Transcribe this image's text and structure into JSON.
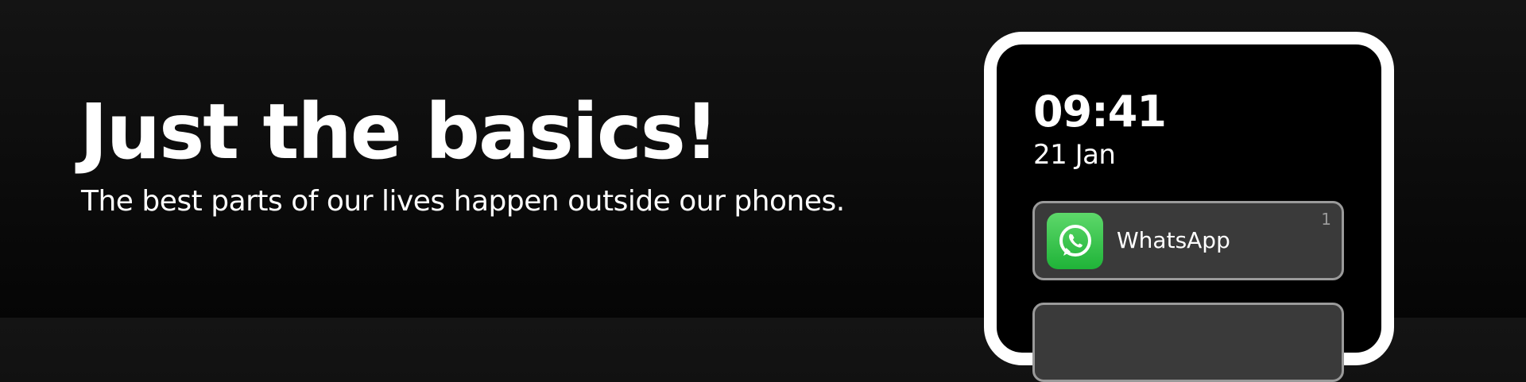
{
  "hero": {
    "title": "Just the basics!",
    "subtitle": "The best parts of our lives happen outside our phones."
  },
  "phone": {
    "time": "09:41",
    "date": "21 Jan",
    "notifications": [
      {
        "app_name": "WhatsApp",
        "count": "1",
        "icon": "whatsapp-icon",
        "icon_color": "#25D366"
      }
    ]
  },
  "colors": {
    "background": "#0c0c0c",
    "phone_frame": "#ffffff",
    "card_background": "#3a3a3a",
    "card_border": "#9a9a9a"
  }
}
